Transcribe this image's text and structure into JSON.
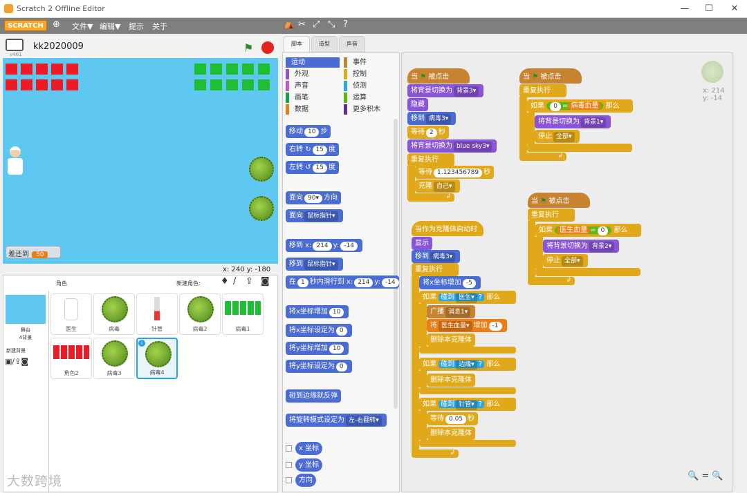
{
  "window": {
    "title": "Scratch 2 Offline Editor",
    "min": "—",
    "max": "☐",
    "close": "✕"
  },
  "menu": {
    "logo": "SCRATCH",
    "file": "文件▼",
    "edit": "编辑▼",
    "tips": "提示",
    "about": "关于"
  },
  "stage": {
    "project_name": "kk2020009",
    "version": "v461",
    "coords": "x: 240  y: -180",
    "monitor_label": "差还到",
    "monitor_value": "50"
  },
  "sprites": {
    "header_label": "角色",
    "new_sprite_label": "新建角色:",
    "stage_label": "舞台",
    "stage_sub": "4背景",
    "new_backdrop": "新建背景",
    "items": [
      {
        "name": "医生"
      },
      {
        "name": "病毒"
      },
      {
        "name": "针管"
      },
      {
        "name": "病毒2"
      },
      {
        "name": "病毒1"
      },
      {
        "name": "角色2"
      },
      {
        "name": "病毒3"
      },
      {
        "name": "病毒4"
      }
    ]
  },
  "tabs": [
    "脚本",
    "造型",
    "声音"
  ],
  "categories": {
    "left": [
      "运动",
      "外观",
      "声音",
      "画笔",
      "数据"
    ],
    "right": [
      "事件",
      "控制",
      "侦测",
      "运算",
      "更多积木"
    ]
  },
  "palette": {
    "move": [
      "移动",
      "10",
      "步"
    ],
    "turn_r": [
      "右转",
      "15",
      "度"
    ],
    "turn_l": [
      "左转",
      "15",
      "度"
    ],
    "point_dir": [
      "面向",
      "90▾",
      "方向"
    ],
    "point_to": [
      "面向",
      "鼠标指针▾"
    ],
    "goto_xy": [
      "移到 x:",
      "214",
      "y:",
      "-14"
    ],
    "goto": [
      "移到",
      "鼠标指针▾"
    ],
    "glide": [
      "在",
      "1",
      "秒内滑行到 x:",
      "214",
      "y:",
      "-14"
    ],
    "change_x": [
      "将x坐标增加",
      "10"
    ],
    "set_x": [
      "将x坐标设定为",
      "0"
    ],
    "change_y": [
      "将y坐标增加",
      "10"
    ],
    "set_y": [
      "将y坐标设定为",
      "0"
    ],
    "bounce": "碰到边缘就反弹",
    "rot_style": [
      "将旋转模式设定为",
      "左-右翻转▾"
    ],
    "rep_x": "x 坐标",
    "rep_y": "y 坐标",
    "rep_dir": "方向"
  },
  "scripts": {
    "s1": {
      "hat": [
        "当",
        "被点击"
      ],
      "b1": [
        "将背景切换为",
        "背景3▾"
      ],
      "b2": "隐藏",
      "b3": [
        "移到",
        "病毒3▾"
      ],
      "b4": [
        "等待",
        "2",
        "秒"
      ],
      "b5": [
        "将背景切换为",
        "blue sky3▾"
      ],
      "forever": "重复执行",
      "f1": [
        "等待",
        "1.123456789",
        "秒"
      ],
      "f2": [
        "克隆",
        "自己▾"
      ]
    },
    "s2": {
      "hat": [
        "当",
        "被点击"
      ],
      "forever": "重复执行",
      "if": [
        "如果",
        "0",
        "=",
        "病毒血量",
        "那么"
      ],
      "i1": [
        "将背景切换为",
        "背景1▾"
      ],
      "i2": [
        "停止",
        "全部▾"
      ]
    },
    "s3": {
      "hat": [
        "当",
        "被点击"
      ],
      "forever": "重复执行",
      "if": [
        "如果",
        "医生血量",
        "=",
        "0",
        "那么"
      ],
      "i1": [
        "将背景切换为",
        "背景2▾"
      ],
      "i2": [
        "停止",
        "全部▾"
      ]
    },
    "s4": {
      "hat": "当作为克隆体启动时",
      "b1": "显示",
      "b2": [
        "移到",
        "病毒3▾"
      ],
      "forever": "重复执行",
      "f1": [
        "将x坐标增加",
        "-5"
      ],
      "if1": [
        "如果",
        "碰到",
        "医生▾",
        "?",
        "那么"
      ],
      "if1_a": [
        "广播",
        "消息1▾"
      ],
      "if1_b": [
        "将",
        "医生血量▾",
        "增加",
        "-1"
      ],
      "if1_c": "删除本克隆体",
      "if2": [
        "如果",
        "碰到",
        "边缘▾",
        "?",
        "那么"
      ],
      "if2_a": "删除本克隆体",
      "if3": [
        "如果",
        "碰到",
        "针管▾",
        "?",
        "那么"
      ],
      "if3_a": [
        "等待",
        "0.05",
        "秒"
      ],
      "if3_b": "删除本克隆体"
    }
  },
  "sprite_info": {
    "x": "x: 214",
    "y": "y: -14"
  },
  "zoom": "🔍 = 🔍",
  "watermark": "大数跨境"
}
